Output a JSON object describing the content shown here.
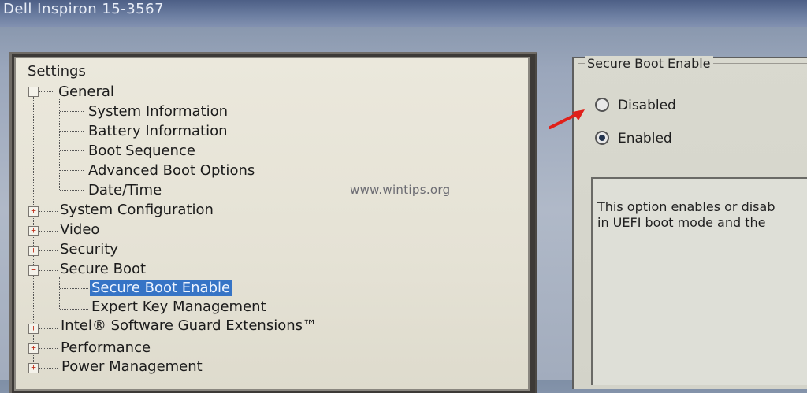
{
  "window": {
    "title": "Dell Inspiron 15-3567"
  },
  "tree": {
    "heading": "Settings",
    "nodes": {
      "general": "General",
      "system_information": "System Information",
      "battery_information": "Battery Information",
      "boot_sequence": "Boot Sequence",
      "advanced_boot_options": "Advanced Boot Options",
      "date_time": "Date/Time",
      "system_configuration": "System Configuration",
      "video": "Video",
      "security": "Security",
      "secure_boot": "Secure Boot",
      "secure_boot_enable": "Secure Boot Enable",
      "expert_key_management": "Expert Key Management",
      "intel_sgx": "Intel® Software Guard Extensions™",
      "performance": "Performance",
      "power_management": "Power Management"
    },
    "expanders": {
      "expanded": "−",
      "collapsed": "+"
    }
  },
  "detail": {
    "group_title": "Secure Boot Enable",
    "options": {
      "disabled": "Disabled",
      "enabled": "Enabled"
    },
    "selected": "Enabled",
    "description_line1": "This option enables or disab",
    "description_line2": "in UEFI boot mode and the"
  },
  "watermark": "www.wintips.org",
  "colors": {
    "selection": "#3674c6",
    "arrow": "#e0201a"
  }
}
